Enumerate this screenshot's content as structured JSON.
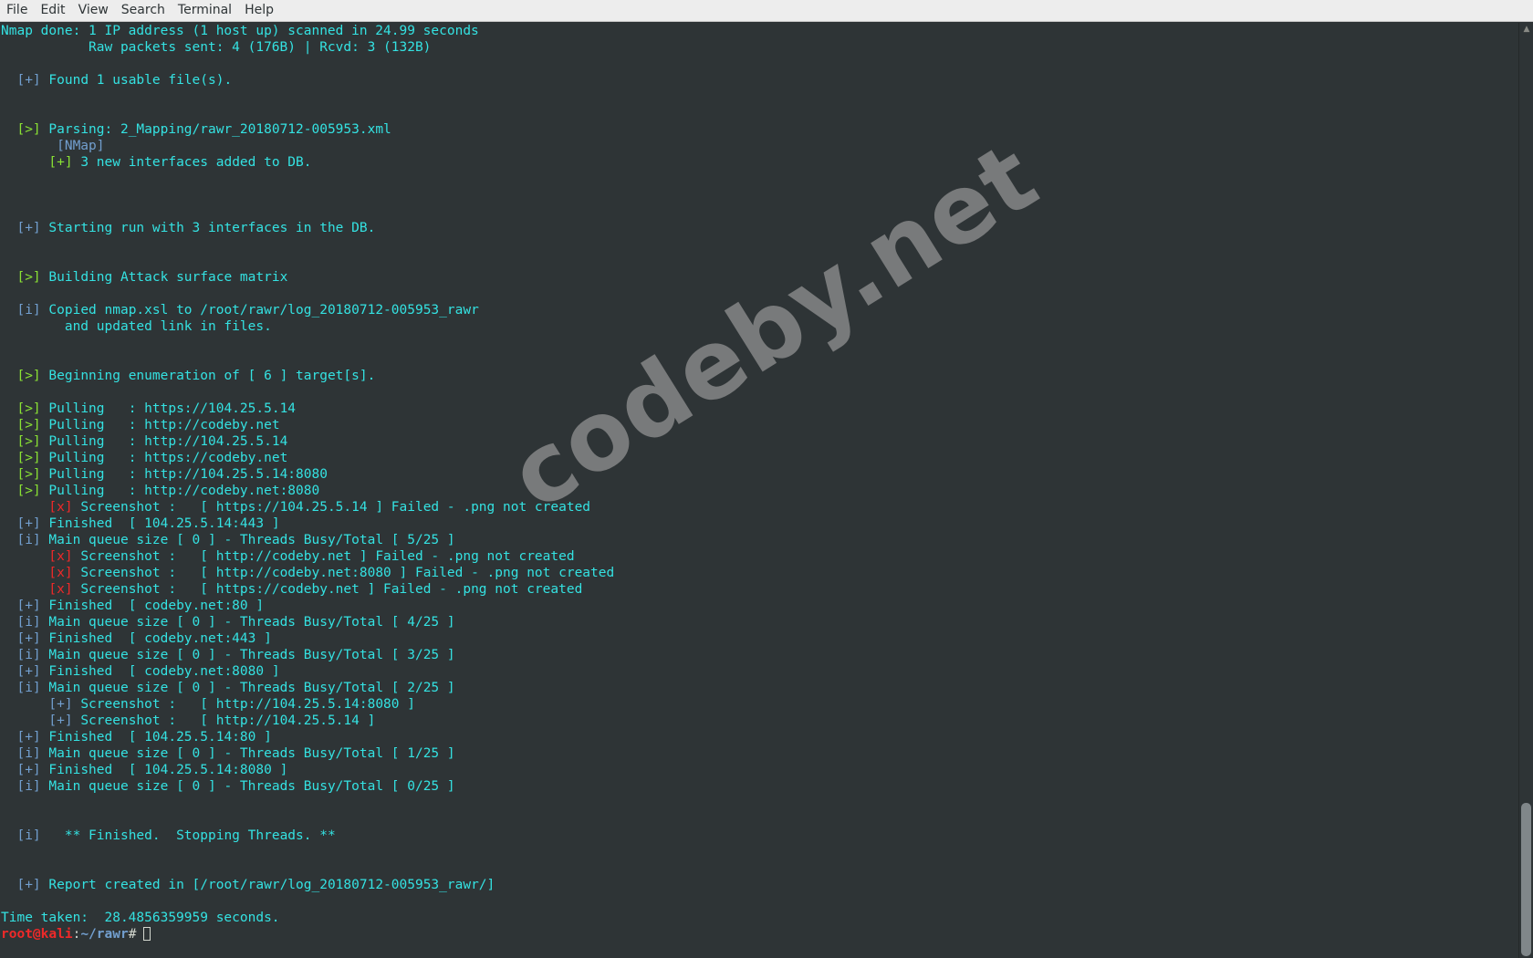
{
  "menubar": {
    "items": [
      "File",
      "Edit",
      "View",
      "Search",
      "Terminal",
      "Help"
    ]
  },
  "terminal": {
    "lines": [
      [
        {
          "t": "Nmap done: 1 IP address (1 host up) scanned in 24.99 seconds",
          "c": "c"
        }
      ],
      [
        {
          "t": "           Raw packets sent: 4 (176B) | Rcvd: 3 (132B)",
          "c": "c"
        }
      ],
      [],
      [
        {
          "t": "  ",
          "c": "c"
        },
        {
          "t": "[+]",
          "c": "b"
        },
        {
          "t": " Found 1 usable file(s).",
          "c": "c"
        }
      ],
      [],
      [],
      [
        {
          "t": "  ",
          "c": "c"
        },
        {
          "t": "[>]",
          "c": "g"
        },
        {
          "t": " Parsing: 2_Mapping/rawr_20180712-005953.xml",
          "c": "c"
        }
      ],
      [
        {
          "t": "       ",
          "c": "c"
        },
        {
          "t": "[NMap]",
          "c": "b"
        }
      ],
      [
        {
          "t": "      ",
          "c": "c"
        },
        {
          "t": "[+]",
          "c": "g"
        },
        {
          "t": " 3 new interfaces added to DB.",
          "c": "c"
        }
      ],
      [],
      [],
      [],
      [
        {
          "t": "  ",
          "c": "c"
        },
        {
          "t": "[+]",
          "c": "b"
        },
        {
          "t": " Starting run with 3 interfaces in the DB.",
          "c": "c"
        }
      ],
      [],
      [],
      [
        {
          "t": "  ",
          "c": "c"
        },
        {
          "t": "[>]",
          "c": "g"
        },
        {
          "t": " Building Attack surface matrix",
          "c": "c"
        }
      ],
      [],
      [
        {
          "t": "  ",
          "c": "c"
        },
        {
          "t": "[i]",
          "c": "b"
        },
        {
          "t": " Copied nmap.xsl to /root/rawr/log_20180712-005953_rawr",
          "c": "c"
        }
      ],
      [
        {
          "t": "        and updated link in files.",
          "c": "c"
        }
      ],
      [],
      [],
      [
        {
          "t": "  ",
          "c": "c"
        },
        {
          "t": "[>]",
          "c": "g"
        },
        {
          "t": " Beginning enumeration of [ 6 ] target[s].",
          "c": "c"
        }
      ],
      [],
      [
        {
          "t": "  ",
          "c": "c"
        },
        {
          "t": "[>]",
          "c": "g"
        },
        {
          "t": " Pulling   : https://104.25.5.14",
          "c": "c"
        }
      ],
      [
        {
          "t": "  ",
          "c": "c"
        },
        {
          "t": "[>]",
          "c": "g"
        },
        {
          "t": " Pulling   : http://codeby.net",
          "c": "c"
        }
      ],
      [
        {
          "t": "  ",
          "c": "c"
        },
        {
          "t": "[>]",
          "c": "g"
        },
        {
          "t": " Pulling   : http://104.25.5.14",
          "c": "c"
        }
      ],
      [
        {
          "t": "  ",
          "c": "c"
        },
        {
          "t": "[>]",
          "c": "g"
        },
        {
          "t": " Pulling   : https://codeby.net",
          "c": "c"
        }
      ],
      [
        {
          "t": "  ",
          "c": "c"
        },
        {
          "t": "[>]",
          "c": "g"
        },
        {
          "t": " Pulling   : http://104.25.5.14:8080",
          "c": "c"
        }
      ],
      [
        {
          "t": "  ",
          "c": "c"
        },
        {
          "t": "[>]",
          "c": "g"
        },
        {
          "t": " Pulling   : http://codeby.net:8080",
          "c": "c"
        }
      ],
      [
        {
          "t": "      ",
          "c": "c"
        },
        {
          "t": "[x]",
          "c": "r"
        },
        {
          "t": " Screenshot :   [ https://104.25.5.14 ] Failed - .png not created",
          "c": "c"
        }
      ],
      [
        {
          "t": "  ",
          "c": "c"
        },
        {
          "t": "[+]",
          "c": "b"
        },
        {
          "t": " Finished  [ 104.25.5.14:443 ]",
          "c": "c"
        }
      ],
      [
        {
          "t": "  ",
          "c": "c"
        },
        {
          "t": "[i]",
          "c": "b"
        },
        {
          "t": " Main queue size [ 0 ] - Threads Busy/Total [ 5/25 ]",
          "c": "c"
        }
      ],
      [
        {
          "t": "      ",
          "c": "c"
        },
        {
          "t": "[x]",
          "c": "r"
        },
        {
          "t": " Screenshot :   [ http://codeby.net ] Failed - .png not created",
          "c": "c"
        }
      ],
      [
        {
          "t": "      ",
          "c": "c"
        },
        {
          "t": "[x]",
          "c": "r"
        },
        {
          "t": " Screenshot :   [ http://codeby.net:8080 ] Failed - .png not created",
          "c": "c"
        }
      ],
      [
        {
          "t": "      ",
          "c": "c"
        },
        {
          "t": "[x]",
          "c": "r"
        },
        {
          "t": " Screenshot :   [ https://codeby.net ] Failed - .png not created",
          "c": "c"
        }
      ],
      [
        {
          "t": "  ",
          "c": "c"
        },
        {
          "t": "[+]",
          "c": "b"
        },
        {
          "t": " Finished  [ codeby.net:80 ]",
          "c": "c"
        }
      ],
      [
        {
          "t": "  ",
          "c": "c"
        },
        {
          "t": "[i]",
          "c": "b"
        },
        {
          "t": " Main queue size [ 0 ] - Threads Busy/Total [ 4/25 ]",
          "c": "c"
        }
      ],
      [
        {
          "t": "  ",
          "c": "c"
        },
        {
          "t": "[+]",
          "c": "b"
        },
        {
          "t": " Finished  [ codeby.net:443 ]",
          "c": "c"
        }
      ],
      [
        {
          "t": "  ",
          "c": "c"
        },
        {
          "t": "[i]",
          "c": "b"
        },
        {
          "t": " Main queue size [ 0 ] - Threads Busy/Total [ 3/25 ]",
          "c": "c"
        }
      ],
      [
        {
          "t": "  ",
          "c": "c"
        },
        {
          "t": "[+]",
          "c": "b"
        },
        {
          "t": " Finished  [ codeby.net:8080 ]",
          "c": "c"
        }
      ],
      [
        {
          "t": "  ",
          "c": "c"
        },
        {
          "t": "[i]",
          "c": "b"
        },
        {
          "t": " Main queue size [ 0 ] - Threads Busy/Total [ 2/25 ]",
          "c": "c"
        }
      ],
      [
        {
          "t": "      ",
          "c": "c"
        },
        {
          "t": "[+]",
          "c": "b"
        },
        {
          "t": " Screenshot :   [ http://104.25.5.14:8080 ]",
          "c": "c"
        }
      ],
      [
        {
          "t": "      ",
          "c": "c"
        },
        {
          "t": "[+]",
          "c": "b"
        },
        {
          "t": " Screenshot :   [ http://104.25.5.14 ]",
          "c": "c"
        }
      ],
      [
        {
          "t": "  ",
          "c": "c"
        },
        {
          "t": "[+]",
          "c": "b"
        },
        {
          "t": " Finished  [ 104.25.5.14:80 ]",
          "c": "c"
        }
      ],
      [
        {
          "t": "  ",
          "c": "c"
        },
        {
          "t": "[i]",
          "c": "b"
        },
        {
          "t": " Main queue size [ 0 ] - Threads Busy/Total [ 1/25 ]",
          "c": "c"
        }
      ],
      [
        {
          "t": "  ",
          "c": "c"
        },
        {
          "t": "[+]",
          "c": "b"
        },
        {
          "t": " Finished  [ 104.25.5.14:8080 ]",
          "c": "c"
        }
      ],
      [
        {
          "t": "  ",
          "c": "c"
        },
        {
          "t": "[i]",
          "c": "b"
        },
        {
          "t": " Main queue size [ 0 ] - Threads Busy/Total [ 0/25 ]",
          "c": "c"
        }
      ],
      [],
      [],
      [
        {
          "t": "  ",
          "c": "c"
        },
        {
          "t": "[i]",
          "c": "b"
        },
        {
          "t": "   ** Finished.  Stopping Threads. **",
          "c": "c"
        }
      ],
      [],
      [],
      [
        {
          "t": "  ",
          "c": "c"
        },
        {
          "t": "[+]",
          "c": "b"
        },
        {
          "t": " Report created in [/root/rawr/log_20180712-005953_rawr/]",
          "c": "c"
        }
      ],
      [],
      [
        {
          "t": "Time taken:  28.4856359959 seconds.",
          "c": "c"
        }
      ]
    ],
    "prompt": {
      "user_host": "root@kali",
      "colon": ":",
      "path": "~/rawr",
      "symbol": "#"
    }
  },
  "watermark": {
    "text": "codeby.net"
  },
  "colors": {
    "background": "#2e3436",
    "text": "#34e2e2",
    "tag_green": "#8ae234",
    "tag_blue": "#729fcf",
    "tag_red": "#ef2929",
    "menubar": "#ededed"
  },
  "icons": {
    "scrollbar_up": "arrow-up-icon"
  }
}
